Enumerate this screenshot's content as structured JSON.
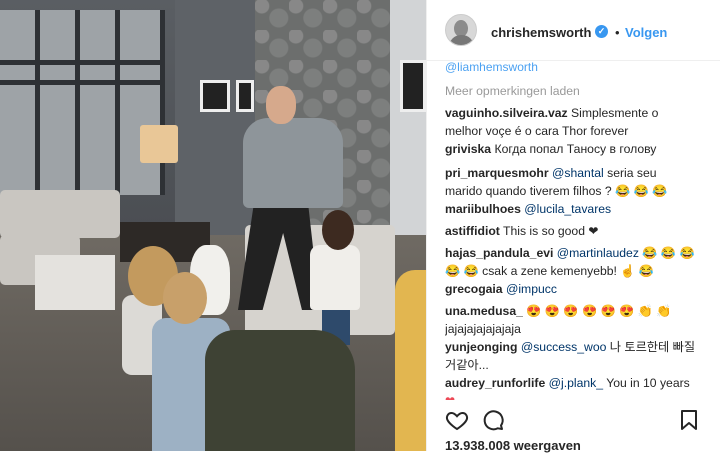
{
  "header": {
    "username": "chrishemsworth",
    "follow_label": "Volgen",
    "separator": "•"
  },
  "comments": {
    "cut_text": "@liamhemsworth",
    "load_more": "Meer opmerkingen laden",
    "items": [
      {
        "user": "vaguinho.silveira.vaz",
        "text": "Simplesmente o",
        "text2": "melhor voçe é o cara Thor forever"
      },
      {
        "user": "griviska",
        "text": "Когда попал Таносу в голову"
      },
      {
        "user": "pri_marquesmohr",
        "mention": "@shantal",
        "text": "seria seu",
        "text2": "marido quando tiverem filhos ? 😂 😂 😂"
      },
      {
        "user": "mariibulhoes",
        "mention": "@lucila_tavares"
      },
      {
        "user": "astiffidiot",
        "text": "This is so good ❤"
      },
      {
        "user": "hajas_pandula_evi",
        "mention": "@martinlaudez",
        "text": "😂 😂 😂",
        "text2": "😂 😂  csak a zene kemenyebb! ☝ 😂"
      },
      {
        "user": "grecogaia",
        "mention": "@impucc"
      },
      {
        "user": "una.medusa_",
        "text": "😍 😍 😍 😍 😍 😍  👏 👏",
        "text2": "jajajajajajajaja"
      },
      {
        "user": "yunjeonging",
        "mention": "@success_woo",
        "text": "나 토르한테 빠질",
        "text2": "거같아..."
      },
      {
        "user": "audrey_runforlife",
        "mention": "@j.plank_",
        "text": "You in 10 years",
        "text2": "❤"
      }
    ]
  },
  "footer": {
    "views": "13.938.008 weergaven"
  },
  "icons": {
    "like": "heart-icon",
    "comment": "comment-icon",
    "save": "bookmark-icon",
    "verified": "verified-badge-icon"
  },
  "colors": {
    "link": "#3897f0",
    "mention": "#003569",
    "heart": "#ed4956"
  }
}
